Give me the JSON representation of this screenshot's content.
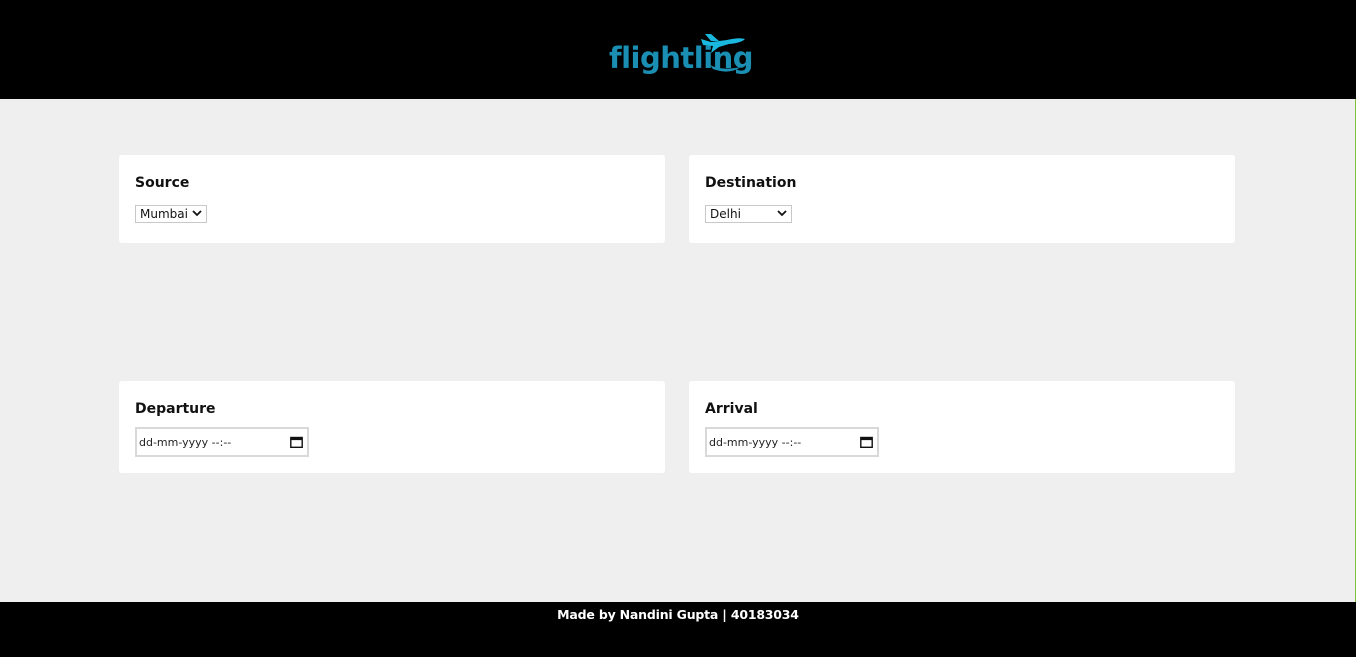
{
  "header": {
    "logo_text": "flightling",
    "colors": {
      "background": "#000000",
      "logo": "#1a8fb3",
      "logo_plane": "#1ab7df"
    }
  },
  "form": {
    "source": {
      "label": "Source",
      "selected": "Mumbai"
    },
    "destination": {
      "label": "Destination",
      "selected": "Delhi"
    },
    "departure": {
      "label": "Departure",
      "value": "dd-mm-yyyy --:--"
    },
    "arrival": {
      "label": "Arrival",
      "value": "dd-mm-yyyy --:--"
    }
  },
  "footer": {
    "text": "Made by Nandini Gupta | 40183034"
  },
  "icons": [
    "plane-icon",
    "chevron-down-icon",
    "calendar-icon"
  ]
}
